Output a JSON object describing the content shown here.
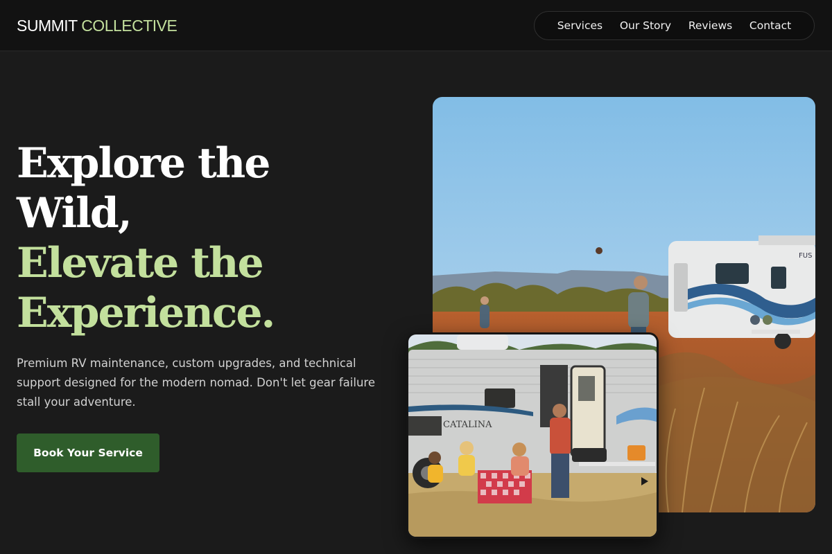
{
  "brand": {
    "part1": "SUMMIT",
    "part2": "COLLECTIVE"
  },
  "nav": {
    "items": [
      "Services",
      "Our Story",
      "Reviews",
      "Contact"
    ]
  },
  "hero": {
    "headline_white": [
      "Explore the",
      "Wild,"
    ],
    "headline_green": [
      "Elevate the",
      "Experience."
    ],
    "description": "Premium RV maintenance, custom upgrades, and technical support designed for the modern nomad. Don't let gear failure stall your adventure.",
    "cta_label": "Book Your Service"
  },
  "images": {
    "main": {
      "rv_text": "FUS"
    },
    "inset": {
      "rv_text": "CATALINA"
    }
  },
  "colors": {
    "background": "#1b1b1b",
    "accent_green": "#c3e09d",
    "button_green": "#2f5d2b",
    "text_muted": "#d2d2d2"
  }
}
